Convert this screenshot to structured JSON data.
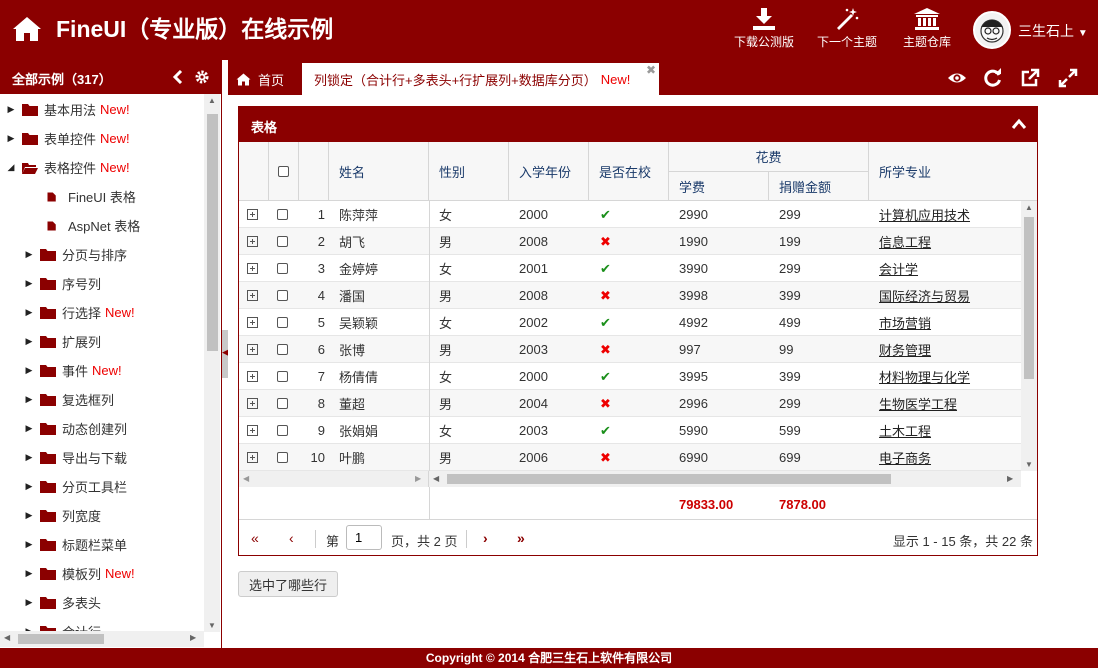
{
  "header": {
    "title": "FineUI（专业版）在线示例",
    "buttons": [
      "下载公测版",
      "下一个主题",
      "主题仓库"
    ],
    "user": "三生石上"
  },
  "sidebar": {
    "title": "全部示例（317）",
    "items": [
      {
        "label": "基本用法",
        "badge": "New!",
        "level": 0,
        "expanded": false,
        "leaf": false
      },
      {
        "label": "表单控件",
        "badge": "New!",
        "level": 0,
        "expanded": false,
        "leaf": false
      },
      {
        "label": "表格控件",
        "badge": "New!",
        "level": 0,
        "expanded": true,
        "leaf": false
      },
      {
        "label": "FineUI 表格",
        "badge": "",
        "level": 1,
        "expanded": false,
        "leaf": true
      },
      {
        "label": "AspNet 表格",
        "badge": "",
        "level": 1,
        "expanded": false,
        "leaf": true
      },
      {
        "label": "分页与排序",
        "badge": "",
        "level": 1,
        "expanded": false,
        "leaf": false
      },
      {
        "label": "序号列",
        "badge": "",
        "level": 1,
        "expanded": false,
        "leaf": false
      },
      {
        "label": "行选择",
        "badge": "New!",
        "level": 1,
        "expanded": false,
        "leaf": false
      },
      {
        "label": "扩展列",
        "badge": "",
        "level": 1,
        "expanded": false,
        "leaf": false
      },
      {
        "label": "事件",
        "badge": "New!",
        "level": 1,
        "expanded": false,
        "leaf": false
      },
      {
        "label": "复选框列",
        "badge": "",
        "level": 1,
        "expanded": false,
        "leaf": false
      },
      {
        "label": "动态创建列",
        "badge": "",
        "level": 1,
        "expanded": false,
        "leaf": false
      },
      {
        "label": "导出与下载",
        "badge": "",
        "level": 1,
        "expanded": false,
        "leaf": false
      },
      {
        "label": "分页工具栏",
        "badge": "",
        "level": 1,
        "expanded": false,
        "leaf": false
      },
      {
        "label": "列宽度",
        "badge": "",
        "level": 1,
        "expanded": false,
        "leaf": false
      },
      {
        "label": "标题栏菜单",
        "badge": "",
        "level": 1,
        "expanded": false,
        "leaf": false
      },
      {
        "label": "模板列",
        "badge": "New!",
        "level": 1,
        "expanded": false,
        "leaf": false
      },
      {
        "label": "多表头",
        "badge": "",
        "level": 1,
        "expanded": false,
        "leaf": false
      },
      {
        "label": "合计行",
        "badge": "",
        "level": 1,
        "expanded": false,
        "leaf": false
      }
    ]
  },
  "tabs": {
    "home": "首页",
    "active_label": "列锁定（合计行+多表头+行扩展列+数据库分页）",
    "active_badge": "New!"
  },
  "panel": {
    "title": "表格"
  },
  "grid": {
    "headers": {
      "name": "姓名",
      "gender": "性别",
      "year": "入学年份",
      "in_school": "是否在校",
      "group_cost": "花费",
      "tuition": "学费",
      "donation": "捐赠金额",
      "major": "所学专业"
    },
    "rows": [
      {
        "no": "1",
        "name": "陈萍萍",
        "gender": "女",
        "year": "2000",
        "in_school": true,
        "tuition": "2990",
        "donation": "299",
        "major": "计算机应用技术"
      },
      {
        "no": "2",
        "name": "胡飞",
        "gender": "男",
        "year": "2008",
        "in_school": false,
        "tuition": "1990",
        "donation": "199",
        "major": "信息工程"
      },
      {
        "no": "3",
        "name": "金婷婷",
        "gender": "女",
        "year": "2001",
        "in_school": true,
        "tuition": "3990",
        "donation": "299",
        "major": "会计学"
      },
      {
        "no": "4",
        "name": "潘国",
        "gender": "男",
        "year": "2008",
        "in_school": false,
        "tuition": "3998",
        "donation": "399",
        "major": "国际经济与贸易"
      },
      {
        "no": "5",
        "name": "吴颖颖",
        "gender": "女",
        "year": "2002",
        "in_school": true,
        "tuition": "4992",
        "donation": "499",
        "major": "市场营销"
      },
      {
        "no": "6",
        "name": "张博",
        "gender": "男",
        "year": "2003",
        "in_school": false,
        "tuition": "997",
        "donation": "99",
        "major": "财务管理"
      },
      {
        "no": "7",
        "name": "杨倩倩",
        "gender": "女",
        "year": "2000",
        "in_school": true,
        "tuition": "3995",
        "donation": "399",
        "major": "材料物理与化学"
      },
      {
        "no": "8",
        "name": "董超",
        "gender": "男",
        "year": "2004",
        "in_school": false,
        "tuition": "2996",
        "donation": "299",
        "major": "生物医学工程"
      },
      {
        "no": "9",
        "name": "张娟娟",
        "gender": "女",
        "year": "2003",
        "in_school": true,
        "tuition": "5990",
        "donation": "599",
        "major": "土木工程"
      },
      {
        "no": "10",
        "name": "叶鹏",
        "gender": "男",
        "year": "2006",
        "in_school": false,
        "tuition": "6990",
        "donation": "699",
        "major": "电子商务"
      }
    ],
    "sum_tuition": "79833.00",
    "sum_donation": "7878.00"
  },
  "pager": {
    "page_label": "第",
    "page_value": "1",
    "total_label": "页，共 2 页",
    "info": "显示 1 - 15 条，共 22 条"
  },
  "select_button": "选中了哪些行",
  "footer": "Copyright © 2014 合肥三生石上软件有限公司"
}
